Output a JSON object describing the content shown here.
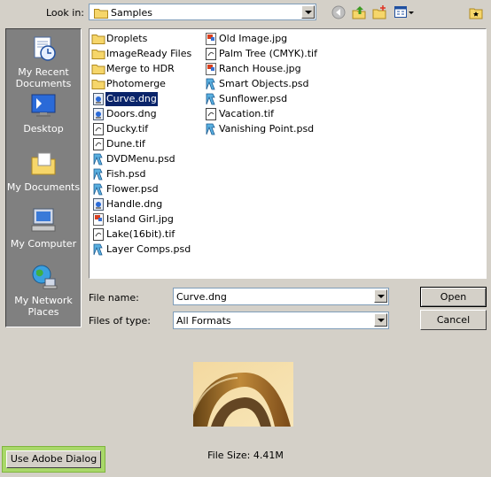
{
  "look_in": {
    "label": "Look in:",
    "value": "Samples"
  },
  "toolbar": {
    "back_icon": "back-arrow-icon",
    "up_icon": "up-folder-icon",
    "new_folder_icon": "new-folder-icon",
    "view_menu_icon": "view-menu-icon",
    "extra_icon": "tools-icon"
  },
  "places": [
    {
      "label": "My Recent\nDocuments",
      "icon": "recent-documents-icon"
    },
    {
      "label": "Desktop",
      "icon": "desktop-icon"
    },
    {
      "label": "My Documents",
      "icon": "my-documents-icon"
    },
    {
      "label": "My Computer",
      "icon": "my-computer-icon"
    },
    {
      "label": "My Network\nPlaces",
      "icon": "network-places-icon"
    }
  ],
  "files": {
    "col1": [
      {
        "name": "Droplets",
        "type": "folder"
      },
      {
        "name": "ImageReady Files",
        "type": "folder"
      },
      {
        "name": "Merge to HDR",
        "type": "folder"
      },
      {
        "name": "Photomerge",
        "type": "folder"
      },
      {
        "name": "Curve.dng",
        "type": "dng",
        "selected": true
      },
      {
        "name": "Doors.dng",
        "type": "dng"
      },
      {
        "name": "Ducky.tif",
        "type": "tif"
      },
      {
        "name": "Dune.tif",
        "type": "tif"
      },
      {
        "name": "DVDMenu.psd",
        "type": "psd"
      },
      {
        "name": "Fish.psd",
        "type": "psd"
      },
      {
        "name": "Flower.psd",
        "type": "psd"
      },
      {
        "name": "Handle.dng",
        "type": "dng"
      },
      {
        "name": "Island Girl.jpg",
        "type": "jpg"
      },
      {
        "name": "Lake(16bit).tif",
        "type": "tif"
      },
      {
        "name": "Layer Comps.psd",
        "type": "psd"
      }
    ],
    "col2": [
      {
        "name": "Old Image.jpg",
        "type": "jpg"
      },
      {
        "name": "Palm Tree (CMYK).tif",
        "type": "tif"
      },
      {
        "name": "Ranch House.jpg",
        "type": "jpg"
      },
      {
        "name": "Smart Objects.psd",
        "type": "psd"
      },
      {
        "name": "Sunflower.psd",
        "type": "psd"
      },
      {
        "name": "Vacation.tif",
        "type": "tif"
      },
      {
        "name": "Vanishing Point.psd",
        "type": "psd"
      }
    ]
  },
  "form": {
    "file_name_label": "File name:",
    "file_name_value": "Curve.dng",
    "files_of_type_label": "Files of type:",
    "files_of_type_value": "All Formats",
    "open_label": "Open",
    "cancel_label": "Cancel"
  },
  "preview": {
    "file_size": "File Size: 4.41M"
  },
  "adobe_button": {
    "label": "Use Adobe Dialog",
    "accent": "#a9d86a"
  },
  "colors": {
    "selection": "#0a246a",
    "places_bg": "#808080",
    "dialog_bg": "#d4d0c8"
  }
}
